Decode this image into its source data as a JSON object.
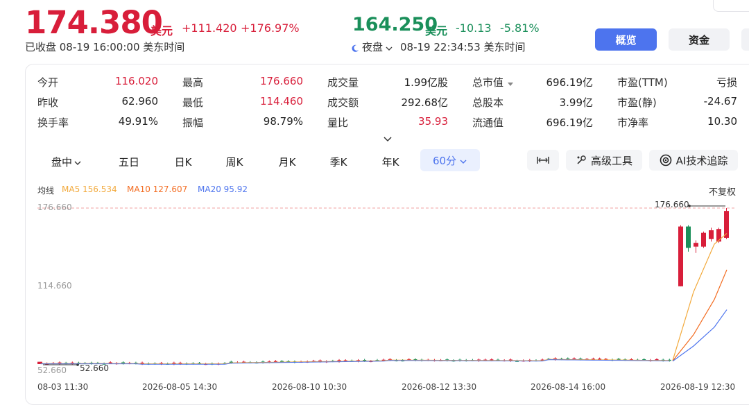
{
  "quote": {
    "price": "174.380",
    "unit": "美元",
    "change": "+111.420",
    "change_pct": "+176.97%",
    "status": "已收盘 08-19 16:00:00 美东时间"
  },
  "after_hours": {
    "price": "164.250",
    "unit": "美元",
    "change": "-10.13",
    "change_pct": "-5.81%",
    "session": "夜盘",
    "time": "08-19 22:34:53 美东时间"
  },
  "buttons": {
    "overview": "概览",
    "funds": "资金"
  },
  "stats": [
    [
      {
        "label": "今开",
        "value": "116.020",
        "color": "red"
      },
      {
        "label": "昨收",
        "value": "62.960",
        "color": "normal"
      },
      {
        "label": "换手率",
        "value": "49.91%",
        "color": "normal"
      }
    ],
    [
      {
        "label": "最高",
        "value": "176.660",
        "color": "red"
      },
      {
        "label": "最低",
        "value": "114.460",
        "color": "red"
      },
      {
        "label": "振幅",
        "value": "98.79%",
        "color": "normal"
      }
    ],
    [
      {
        "label": "成交量",
        "value": "1.99亿股",
        "color": "normal"
      },
      {
        "label": "成交额",
        "value": "292.68亿",
        "color": "normal"
      },
      {
        "label": "量比",
        "value": "35.93",
        "color": "red"
      }
    ],
    [
      {
        "label": "总市值",
        "value": "696.19亿",
        "color": "normal"
      },
      {
        "label": "总股本",
        "value": "3.99亿",
        "color": "normal"
      },
      {
        "label": "流通值",
        "value": "696.19亿",
        "color": "normal"
      }
    ],
    [
      {
        "label": "市盈(TTM)",
        "value": "亏损",
        "color": "normal"
      },
      {
        "label": "市盈(静)",
        "value": "-24.67",
        "color": "normal"
      },
      {
        "label": "市净率",
        "value": "10.30",
        "color": "normal"
      }
    ]
  ],
  "tabs": [
    "盘中",
    "五日",
    "日K",
    "周K",
    "月K",
    "季K",
    "年K",
    "60分"
  ],
  "active_tab": "60分",
  "tools": {
    "ruler": "",
    "advanced": "高级工具",
    "ai": "AI技术追踪"
  },
  "ma": {
    "title": "均线",
    "ma5": "MA5 156.534",
    "ma10": "MA10 127.607",
    "ma20": "MA20 95.92",
    "adjust": "不复权",
    "colors": {
      "ma5": "#f2a93b",
      "ma10": "#f36c21",
      "ma20": "#4d74ee"
    }
  },
  "chart_data": {
    "type": "candlestick",
    "y_labels": [
      "176.660",
      "114.660",
      "52.660"
    ],
    "high_marker": "176.660",
    "low_marker": "52.660",
    "x_labels": [
      "08-03 11:30",
      "2026-08-05 14:30",
      "2026-08-10 10:30",
      "2026-08-12 13:30",
      "2026-08-14 16:00",
      "2026-08-19 12:30"
    ],
    "ylim": [
      52.66,
      176.66
    ],
    "candles_flat_level_approx": [
      53,
      56
    ],
    "last_candles": [
      {
        "open": 114.5,
        "close": 162.0,
        "high": 163.0,
        "low": 114.46
      },
      {
        "open": 162.0,
        "close": 145.0,
        "high": 163.0,
        "low": 142.0
      },
      {
        "open": 146.0,
        "close": 149.0,
        "high": 151.0,
        "low": 141.0
      },
      {
        "open": 146.0,
        "close": 157.0,
        "high": 158.0,
        "low": 145.0
      },
      {
        "open": 152.0,
        "close": 159.0,
        "high": 161.0,
        "low": 150.0
      },
      {
        "open": 150.0,
        "close": 160.0,
        "high": 161.0,
        "low": 149.0
      },
      {
        "open": 153.0,
        "close": 174.38,
        "high": 176.66,
        "low": 152.0
      }
    ]
  },
  "icons": {
    "moon": "moon-icon",
    "chevron": "chevron-down-icon",
    "expand": "expand-chevron-icon"
  }
}
